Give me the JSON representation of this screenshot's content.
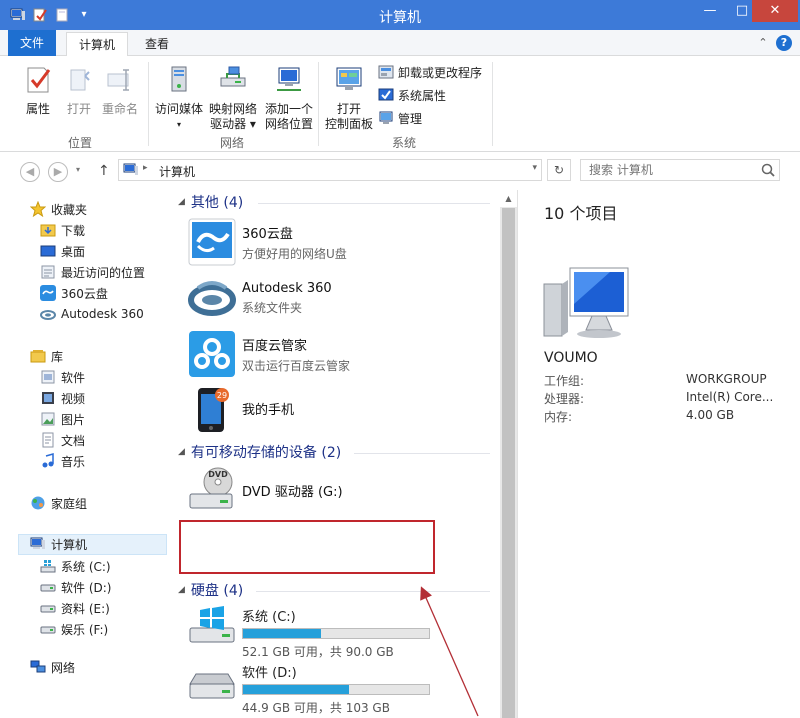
{
  "window": {
    "title": "计算机",
    "controls": {
      "minimize": "—",
      "maximize": "□",
      "close": "✕"
    }
  },
  "ribbon_tabs": {
    "file": "文件",
    "computer": "计算机",
    "view": "查看"
  },
  "ribbon": {
    "location_group": {
      "label": "位置",
      "properties": "属性",
      "open": "打开",
      "rename": "重命名"
    },
    "network_group": {
      "label": "网络",
      "access_media": "访问媒体",
      "map_drive_line1": "映射网络",
      "map_drive_line2": "驱动器 ▾",
      "add_location_line1": "添加一个",
      "add_location_line2": "网络位置"
    },
    "system_group": {
      "label": "系统",
      "control_panel_line1": "打开",
      "control_panel_line2": "控制面板",
      "uninstall": "卸载或更改程序",
      "system_properties": "系统属性",
      "manage": "管理"
    }
  },
  "address_bar": {
    "path": "计算机",
    "search_placeholder": "搜索 计算机"
  },
  "nav_pane": {
    "favorites": {
      "label": "收藏夹",
      "items": [
        "下载",
        "桌面",
        "最近访问的位置",
        "360云盘",
        "Autodesk 360"
      ]
    },
    "libraries": {
      "label": "库",
      "items": [
        "软件",
        "视频",
        "图片",
        "文档",
        "音乐"
      ]
    },
    "homegroup": "家庭组",
    "computer": {
      "label": "计算机",
      "items": [
        "系统 (C:)",
        "软件 (D:)",
        "资料 (E:)",
        "娱乐 (F:)"
      ]
    },
    "network": "网络"
  },
  "content": {
    "groups": {
      "other": "其他 (4)",
      "removable": "有可移动存储的设备 (2)",
      "harddisk": "硬盘 (4)"
    },
    "other_items": [
      {
        "name": "360云盘",
        "desc": "方便好用的网络U盘"
      },
      {
        "name": "Autodesk 360",
        "desc": "系统文件夹"
      },
      {
        "name": "百度云管家",
        "desc": "双击运行百度云管家"
      },
      {
        "name": "我的手机",
        "desc": ""
      }
    ],
    "phone_badge": "29",
    "dvd": {
      "name": "DVD 驱动器 (G:)",
      "icon_label": "DVD"
    },
    "drives": [
      {
        "name": "系统 (C:)",
        "size": "52.1 GB 可用，共 90.0 GB",
        "used_fraction": 0.42
      },
      {
        "name": "软件 (D:)",
        "size": "44.9 GB 可用，共 103 GB",
        "used_fraction": 0.57
      }
    ]
  },
  "details_pane": {
    "count": "10 个项目",
    "computer_name": "VOUMO",
    "rows": [
      {
        "label": "工作组:",
        "value": "WORKGROUP"
      },
      {
        "label": "处理器:",
        "value": "Intel(R) Core..."
      },
      {
        "label": "内存:",
        "value": "4.00 GB"
      }
    ]
  },
  "colors": {
    "titlebar": "#3d7ad8",
    "file_tab": "#1e6fd0",
    "close_button": "#c7463d",
    "usage_bar": "#26a0da",
    "annotation_red": "#c0262d"
  }
}
